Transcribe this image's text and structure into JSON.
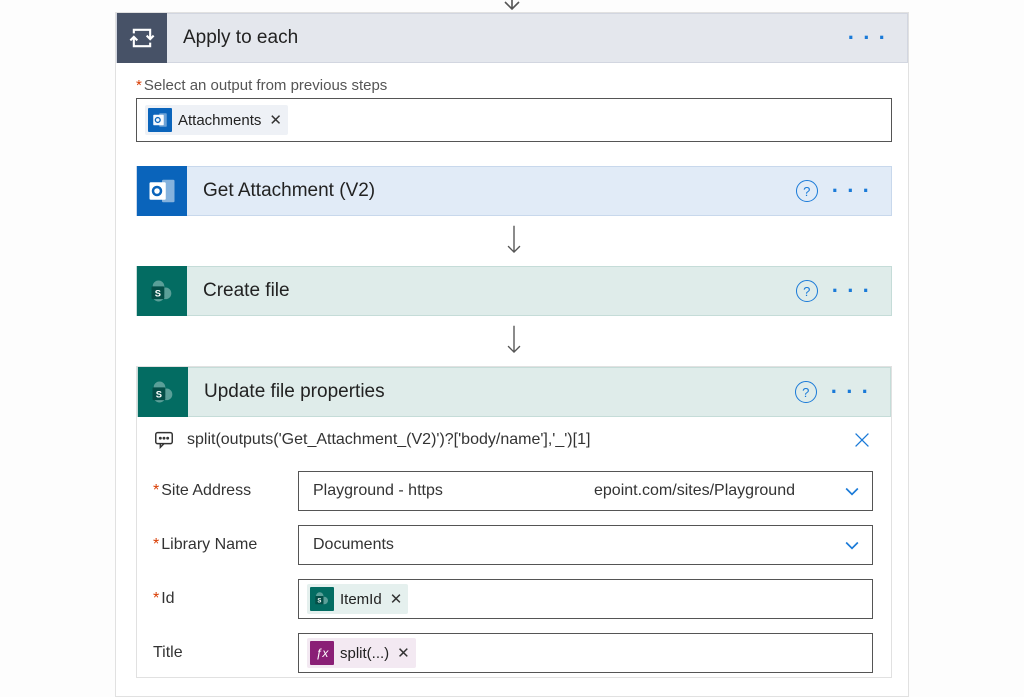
{
  "apply_to_each": {
    "title": "Apply to each",
    "select_output_label": "Select an output from previous steps",
    "attachments_token": "Attachments"
  },
  "get_attachment": {
    "title": "Get Attachment (V2)"
  },
  "create_file": {
    "title": "Create file"
  },
  "update_file": {
    "title": "Update file properties",
    "expression": "split(outputs('Get_Attachment_(V2)')?['body/name'],'_')[1]",
    "fields": {
      "site_address": {
        "label": "Site Address",
        "value": "Playground - https                                  epoint.com/sites/Playground"
      },
      "library_name": {
        "label": "Library Name",
        "value": "Documents"
      },
      "id": {
        "label": "Id",
        "token": "ItemId"
      },
      "title": {
        "label": "Title",
        "token": "split(...)"
      }
    }
  },
  "icons": {
    "fx": "ƒx"
  }
}
